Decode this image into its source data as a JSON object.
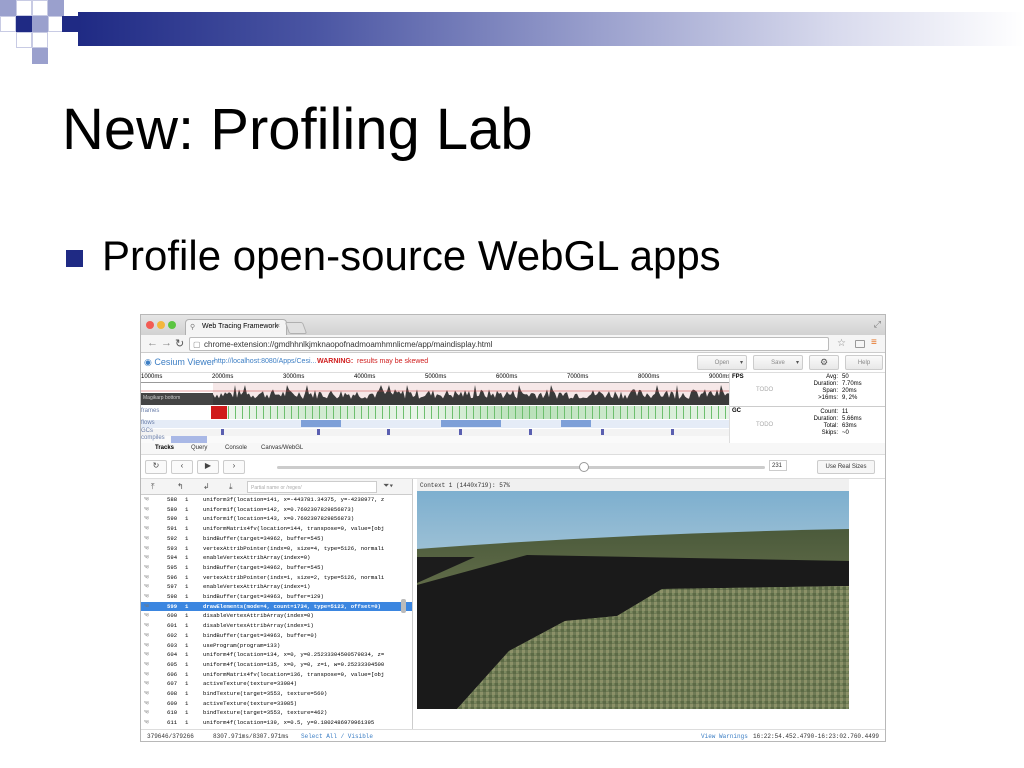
{
  "slide": {
    "title": "New: Profiling Lab",
    "bullet": "Profile open-source WebGL apps",
    "accent_color": "#1f2a84"
  },
  "browser": {
    "tab_title": "Web Tracing Framework",
    "tab_close": "×",
    "address": "chrome-extension://gmdhhnlkjmknaopofnadmoamhmnlicme/app/maindisplay.html"
  },
  "app": {
    "brand": "Cesium Viewer",
    "url": "http://localhost:8080/Apps/Cesi...",
    "warning_label": "WARNING:",
    "warning_text": "results may be skewed",
    "open_label": "Open",
    "save_label": "Save",
    "help_label": "Help"
  },
  "timeline": {
    "ruler_labels": [
      "1000ms",
      "2000ms",
      "3000ms",
      "4000ms",
      "5000ms",
      "6000ms",
      "7000ms",
      "8000ms",
      "9000ms"
    ],
    "graph_left_label": "Magikarp bottom",
    "row_labels": [
      "frames",
      "flows",
      "GCs",
      "compiles"
    ]
  },
  "stats": {
    "fps": {
      "title": "FPS",
      "todo": "TODO",
      "rows": [
        {
          "k": "Avg:",
          "v": "50"
        },
        {
          "k": "Duration:",
          "v": "7.70ms"
        },
        {
          "k": "Span:",
          "v": "20ms"
        },
        {
          "k": ">16ms:",
          "v": "9, 2%"
        }
      ]
    },
    "gc": {
      "title": "GC",
      "todo": "TODO",
      "rows": [
        {
          "k": "Count:",
          "v": "11"
        },
        {
          "k": "Duration:",
          "v": "5.66ms"
        },
        {
          "k": "Total:",
          "v": "63ms"
        },
        {
          "k": "Skips:",
          "v": "~0"
        }
      ]
    }
  },
  "tabs": [
    "Tracks",
    "Query",
    "Console",
    "Canvas/WebGL"
  ],
  "player": {
    "frame_value": "231",
    "real_sizes_label": "Use Real Sizes"
  },
  "calls": {
    "filter_placeholder": "Partial name or /regex/",
    "selected_index": 11,
    "rows": [
      {
        "n": "588",
        "c": "1",
        "call": "uniform3f(location=141, x=-443781.34375, y=-4238977, z"
      },
      {
        "n": "589",
        "c": "1",
        "call": "uniform1f(location=142, x=0.7692307829856873)"
      },
      {
        "n": "590",
        "c": "1",
        "call": "uniform1f(location=143, x=0.7692307829856873)"
      },
      {
        "n": "591",
        "c": "1",
        "call": "uniformMatrix4fv(location=144, transpose=0, value=[obj"
      },
      {
        "n": "592",
        "c": "1",
        "call": "bindBuffer(target=34962, buffer=545)"
      },
      {
        "n": "593",
        "c": "1",
        "call": "vertexAttribPointer(indx=0, size=4, type=5126, normali"
      },
      {
        "n": "594",
        "c": "1",
        "call": "enableVertexAttribArray(index=0)"
      },
      {
        "n": "595",
        "c": "1",
        "call": "bindBuffer(target=34962, buffer=545)"
      },
      {
        "n": "596",
        "c": "1",
        "call": "vertexAttribPointer(indx=1, size=2, type=5126, normali"
      },
      {
        "n": "597",
        "c": "1",
        "call": "enableVertexAttribArray(index=1)"
      },
      {
        "n": "598",
        "c": "1",
        "call": "bindBuffer(target=34963, buffer=129)"
      },
      {
        "n": "599",
        "c": "1",
        "call": "drawElements(mode=4, count=1734, type=5123, offset=0)"
      },
      {
        "n": "600",
        "c": "1",
        "call": "disableVertexAttribArray(index=0)"
      },
      {
        "n": "601",
        "c": "1",
        "call": "disableVertexAttribArray(index=1)"
      },
      {
        "n": "602",
        "c": "1",
        "call": "bindBuffer(target=34963, buffer=0)"
      },
      {
        "n": "603",
        "c": "1",
        "call": "useProgram(program=133)"
      },
      {
        "n": "604",
        "c": "1",
        "call": "uniform4f(location=134, x=0, y=0.25233304500579834, z="
      },
      {
        "n": "605",
        "c": "1",
        "call": "uniform4f(location=135, x=0, y=0, z=1, w=0.25233304500"
      },
      {
        "n": "606",
        "c": "1",
        "call": "uniformMatrix4fv(location=136, transpose=0, value=[obj"
      },
      {
        "n": "607",
        "c": "1",
        "call": "activeTexture(texture=33984)"
      },
      {
        "n": "608",
        "c": "1",
        "call": "bindTexture(target=3553, texture=560)"
      },
      {
        "n": "609",
        "c": "1",
        "call": "activeTexture(texture=33985)"
      },
      {
        "n": "610",
        "c": "1",
        "call": "bindTexture(target=3553, texture=462)"
      },
      {
        "n": "611",
        "c": "1",
        "call": "uniform4f(location=139, x=0.5, y=0.1802486979961395"
      }
    ]
  },
  "canvas": {
    "context_label": "Context 1 (1440x719): 57%"
  },
  "status": {
    "events": "379646/379266",
    "time": "8307.971ms/8307.971ms",
    "select": "Select All / Visible",
    "warnings": "View Warnings",
    "range": "16:22:54.452.4790-16:23:02.760.4499"
  }
}
